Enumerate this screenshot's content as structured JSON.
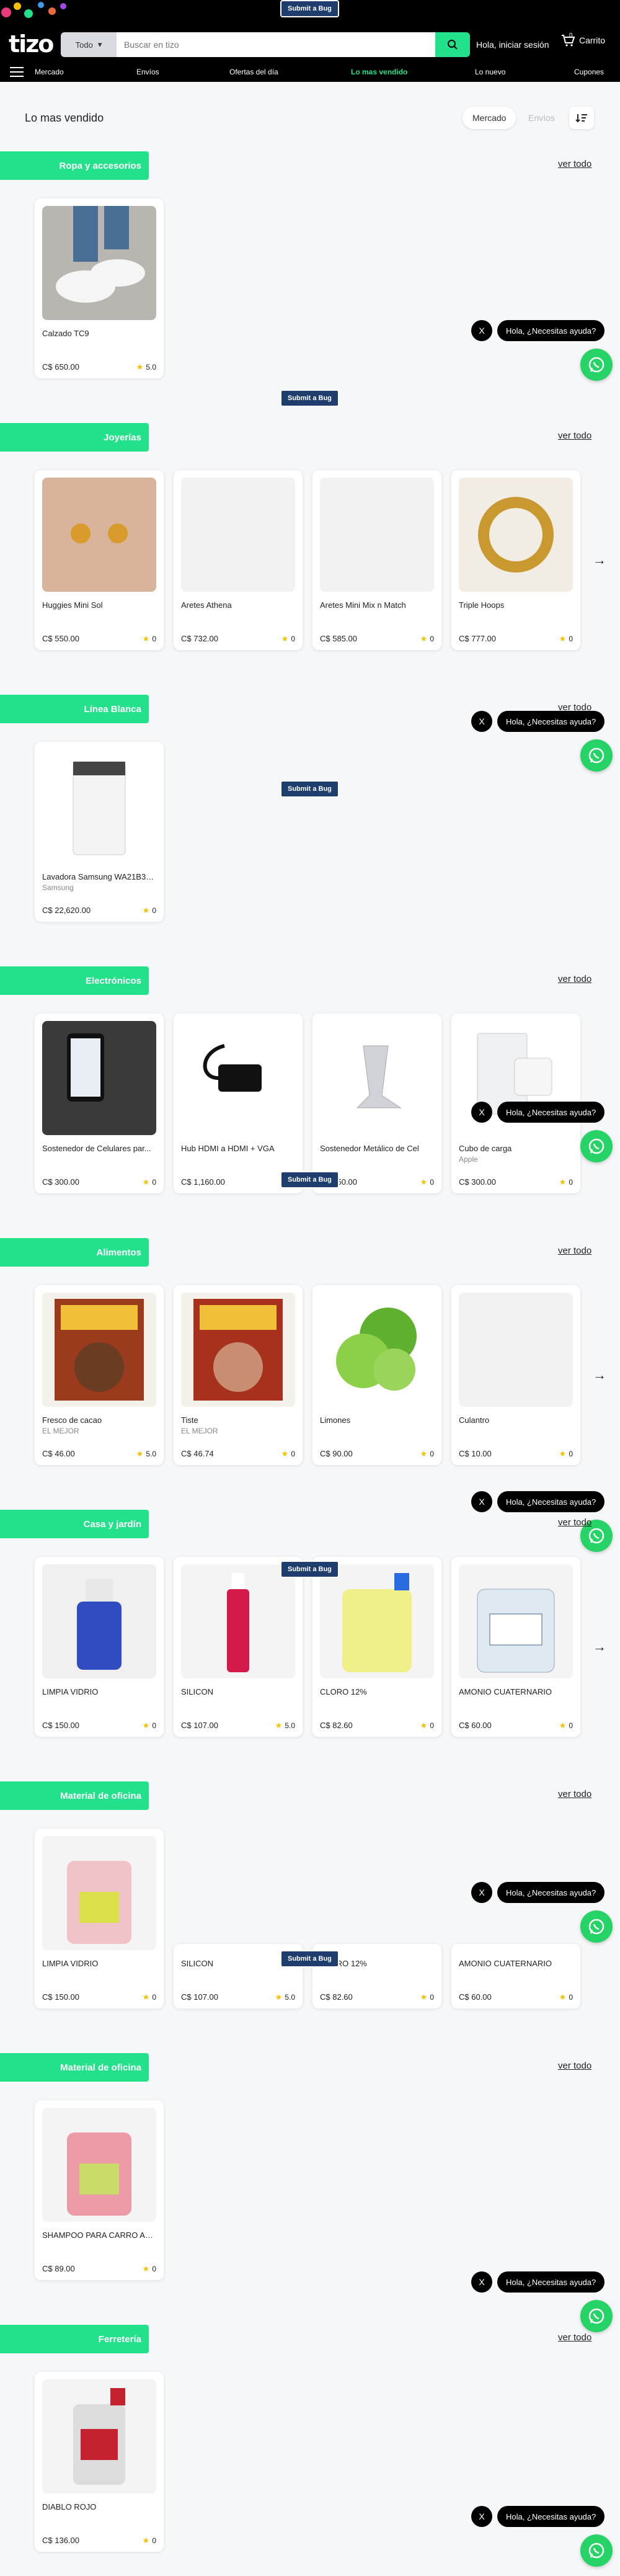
{
  "header": {
    "logo": "tizo",
    "category_label": "Todo",
    "search_placeholder": "Buscar en tizo",
    "greeting": "Hola, iniciar sesión",
    "cart_label": "Carrito",
    "cart_count": "0",
    "submit_bug": "Submit a Bug"
  },
  "nav": {
    "items": [
      "Mercado",
      "Envíos",
      "Ofertas del día",
      "Lo mas vendido",
      "Lo nuevo",
      "Cupones"
    ],
    "active": "Lo mas vendido"
  },
  "page": {
    "title": "Lo mas vendido",
    "chip_active": "Mercado",
    "chip_disabled": "Envíos"
  },
  "sections": [
    {
      "title": "Ropa y accesorios",
      "see_all": "ver todo",
      "products": [
        {
          "name": "Calzado TC9",
          "brand": "",
          "price": "C$ 650.00",
          "rating": "5.0"
        }
      ]
    },
    {
      "title": "Joyerías",
      "see_all": "ver todo",
      "products": [
        {
          "name": "Huggies Mini Sol",
          "brand": "",
          "price": "C$ 550.00",
          "rating": "0"
        },
        {
          "name": "Aretes Athena",
          "brand": "",
          "price": "C$ 732.00",
          "rating": "0"
        },
        {
          "name": "Aretes Mini Mix n Match",
          "brand": "",
          "price": "C$ 585.00",
          "rating": "0"
        },
        {
          "name": "Triple Hoops",
          "brand": "",
          "price": "C$ 777.00",
          "rating": "0"
        }
      ]
    },
    {
      "title": "Línea Blanca",
      "see_all": "ver todo",
      "products": [
        {
          "name": "Lavadora Samsung WA21B355...",
          "brand": "Samsung",
          "price": "C$ 22,620.00",
          "rating": "0"
        }
      ]
    },
    {
      "title": "Electrónicos",
      "see_all": "ver todo",
      "products": [
        {
          "name": "Sostenedor de Celulares par...",
          "brand": "",
          "price": "C$ 300.00",
          "rating": "0"
        },
        {
          "name": "Hub HDMI a HDMI + VGA",
          "brand": "",
          "price": "C$ 1,160.00",
          "rating": "0"
        },
        {
          "name": "Sostenedor Metálico de Cel",
          "brand": "",
          "price": "C$ 150.00",
          "rating": "0"
        },
        {
          "name": "Cubo de carga",
          "brand": "Apple",
          "price": "C$ 300.00",
          "rating": "0"
        }
      ]
    },
    {
      "title": "Alimentos",
      "see_all": "ver todo",
      "products": [
        {
          "name": "Fresco de cacao",
          "brand": "EL MEJOR",
          "price": "C$ 46.00",
          "rating": "5.0"
        },
        {
          "name": "Tiste",
          "brand": "EL MEJOR",
          "price": "C$ 46.74",
          "rating": "0"
        },
        {
          "name": "Limones",
          "brand": "",
          "price": "C$ 90.00",
          "rating": "0"
        },
        {
          "name": "Culantro",
          "brand": "",
          "price": "C$ 10.00",
          "rating": "0"
        }
      ]
    },
    {
      "title": "Casa y jardín",
      "see_all": "ver todo",
      "products": [
        {
          "name": "LIMPIA VIDRIO",
          "brand": "",
          "price": "C$ 150.00",
          "rating": "0"
        },
        {
          "name": "SILICON",
          "brand": "",
          "price": "C$ 107.00",
          "rating": "5.0"
        },
        {
          "name": "CLORO 12%",
          "brand": "",
          "price": "C$ 82.60",
          "rating": "0"
        },
        {
          "name": "AMONIO CUATERNARIO",
          "brand": "",
          "price": "C$ 60.00",
          "rating": "0"
        }
      ]
    },
    {
      "title": "Material de oficina",
      "see_all": "ver todo",
      "products": [
        {
          "name": "LIMPIA VIDRIO",
          "brand": "",
          "price": "C$ 150.00",
          "rating": "0"
        },
        {
          "name": "SILICON",
          "brand": "",
          "price": "C$ 107.00",
          "rating": "5.0"
        },
        {
          "name": "CLORO 12%",
          "brand": "",
          "price": "C$ 82.60",
          "rating": "0"
        },
        {
          "name": "AMONIO CUATERNARIO",
          "brand": "",
          "price": "C$ 60.00",
          "rating": "0"
        }
      ]
    },
    {
      "title": "Material de oficina",
      "see_all": "ver todo",
      "products": [
        {
          "name": "SHAMPOO PARA CARRO AC...",
          "brand": "",
          "price": "C$ 89.00",
          "rating": "0"
        }
      ]
    },
    {
      "title": "Ferretería",
      "see_all": "ver todo",
      "products": [
        {
          "name": "DIABLO ROJO",
          "brand": "",
          "price": "C$ 136.00",
          "rating": "0"
        }
      ]
    }
  ],
  "help": {
    "close": "X",
    "label": "Hola, ¿Necesitas ayuda?"
  },
  "colors": {
    "accent": "#23e18a",
    "header_bg": "#000000",
    "whatsapp": "#25d366"
  }
}
